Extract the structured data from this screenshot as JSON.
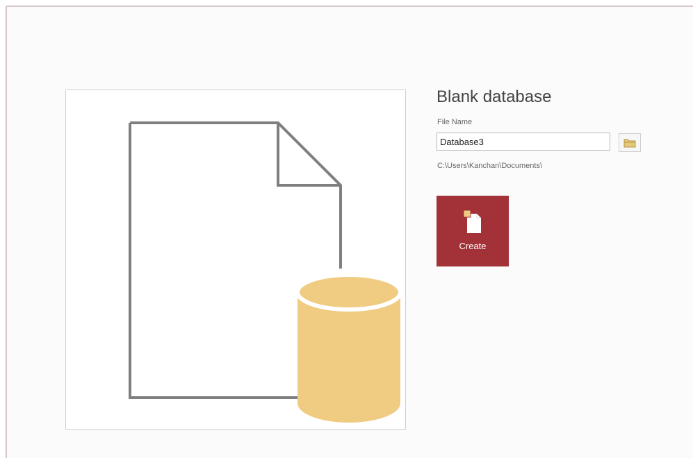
{
  "form": {
    "title": "Blank database",
    "file_name_label": "File Name",
    "file_name_value": "Database3",
    "file_path": "C:\\Users\\Kanchan\\Documents\\",
    "create_label": "Create"
  },
  "icons": {
    "preview": "blank-database-icon",
    "browse": "folder-icon",
    "create": "new-database-icon"
  },
  "colors": {
    "accent": "#a33138",
    "database": "#f0cc82",
    "outline": "#7f7f7f"
  }
}
